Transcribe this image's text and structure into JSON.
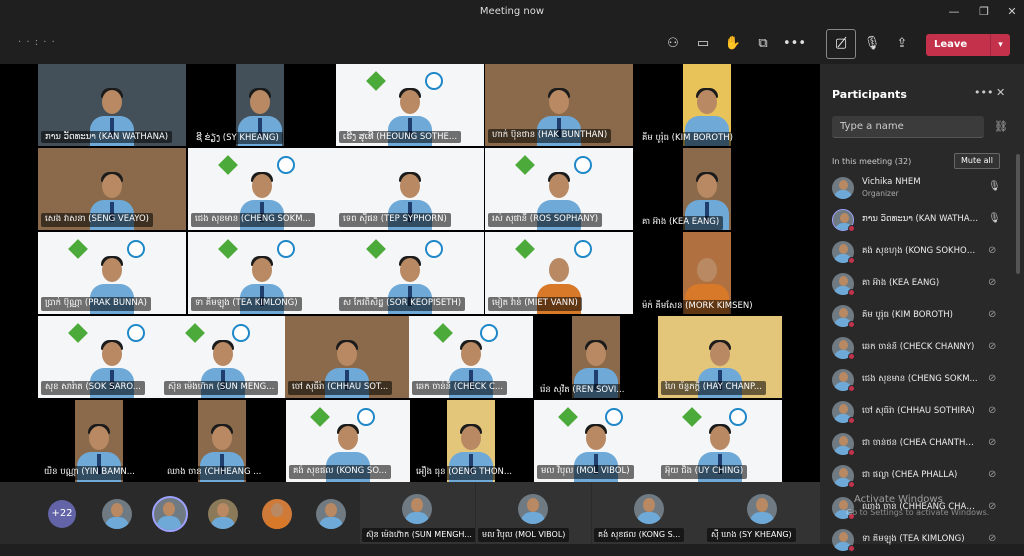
{
  "window": {
    "title": "Meeting now"
  },
  "toolbar": {
    "timer": "· · : · ·",
    "leave_label": "Leave",
    "icons": [
      "participants-icon",
      "chat-icon",
      "raise-hand-icon",
      "breakout-icon",
      "more-icon",
      "camera-off-icon",
      "mic-icon",
      "share-icon"
    ]
  },
  "colors": {
    "leave": "#c4314b",
    "accent": "#6264a7",
    "panel_bg": "#292929"
  },
  "tiles": [
    "ການ ວັດທະນາ (KAN WATHANA)",
    "ຊີ ຂ່ຽງ (SY KHEANG)",
    "ເຮີງ ສຸເທີ (HEOUNG SOTHE...",
    "ហាក់ ប៊ុនថាន (HAK BUNTHAN)",
    "គីម បូរ៉ុធ (KIM BOROTH)",
    "សេង វាសនា (SENG VEAYO)",
    "ជេង សុខមាន (CHENG SOKM...",
    "ទេព ស៊ីផន (TEP SYPHORN)",
    "រស់ សុផានី (ROS SOPHANY)",
    "គា អ៊ាង (KEA EANG)",
    "ប្រាក់ ប៊ុណ្ណា (PRAK BUNNA)",
    "ទា គីមឡុង (TEA KIMLONG)",
    "ស កែវពិសិដ្ឋ (SOR KEOPISETH)",
    "មៀត វ៉ាន់ (MIET VANN)",
    "ម៉ក់ គីមសែន (MORK KIMSEN)",
    "សុខ សារ៉ាត (SOK SARO...",
    "ស៊ុន ម៉េងហ៊ាក (SUN MENG...",
    "ចៅ សុធីរ៉ា (CHHAU SOT...",
    "ឆេក ចាន់នី (CHECK C...",
    "រ៉េន សុវិត (REN SOVI...",
    "ហៃ ច័ន្ទភក្តី (HAY CHANP...",
    "យិន បណ្ណា (YIN BAMN...",
    "ឈាង ចាន (CHHEANG ...",
    "គង់ សុខផល (KONG SO...",
    "អឿង ធុន (OENG THON...",
    "មល វិបុល (MOL VIBOL)",
    "អ៊ុយ ជិង (UY CHING)"
  ],
  "strip": {
    "overflow": "+22",
    "tiles": [
      "ស៊ុន ម៉េងហ៊ាក (SUN MENGH...",
      "មល វិបុល (MOL VIBOL)",
      "គង់ សុខផល (KONG S...",
      "ស៊ី ឃាង (SY KHEANG)"
    ]
  },
  "panel": {
    "title": "Participants",
    "search_placeholder": "Type a name",
    "section": "In this meeting (32)",
    "mute_all": "Mute all",
    "participants": [
      {
        "name": "Vichika NHEM",
        "role": "Organizer",
        "mic": "on"
      },
      {
        "name": "ການ ວັດທະນາ (KAN WATHANA)",
        "role": "",
        "mic": "on"
      },
      {
        "name": "គង់ សុខហុង (KONG SOKHOR...",
        "role": "",
        "mic": "off"
      },
      {
        "name": "គា អ៊ាង (KEA EANG)",
        "role": "",
        "mic": "off"
      },
      {
        "name": "គីម បូរ៉ុធ (KIM BOROTH)",
        "role": "",
        "mic": "off"
      },
      {
        "name": "ឆេក ចាន់នី (CHECK CHANNY)",
        "role": "",
        "mic": "off"
      },
      {
        "name": "ជេង សុខមាន (CHENG SOKM...",
        "role": "",
        "mic": "off"
      },
      {
        "name": "ចៅ សុធីរ៉ា (CHHAU SOTHIRA)",
        "role": "",
        "mic": "off"
      },
      {
        "name": "ជា ចាន់ថន (CHEA CHANTHOR)",
        "role": "",
        "mic": "off"
      },
      {
        "name": "ជា ផល្លា (CHEA PHALLA)",
        "role": "",
        "mic": "off"
      },
      {
        "name": "ឈាង ចាន (CHHEANG CHAN...",
        "role": "",
        "mic": "off"
      },
      {
        "name": "ទា គីមឡុង (TEA KIMLONG)",
        "role": "",
        "mic": "off"
      }
    ]
  },
  "watermark": {
    "line1": "Activate Windows",
    "line2": "Go to Settings to activate Windows."
  }
}
